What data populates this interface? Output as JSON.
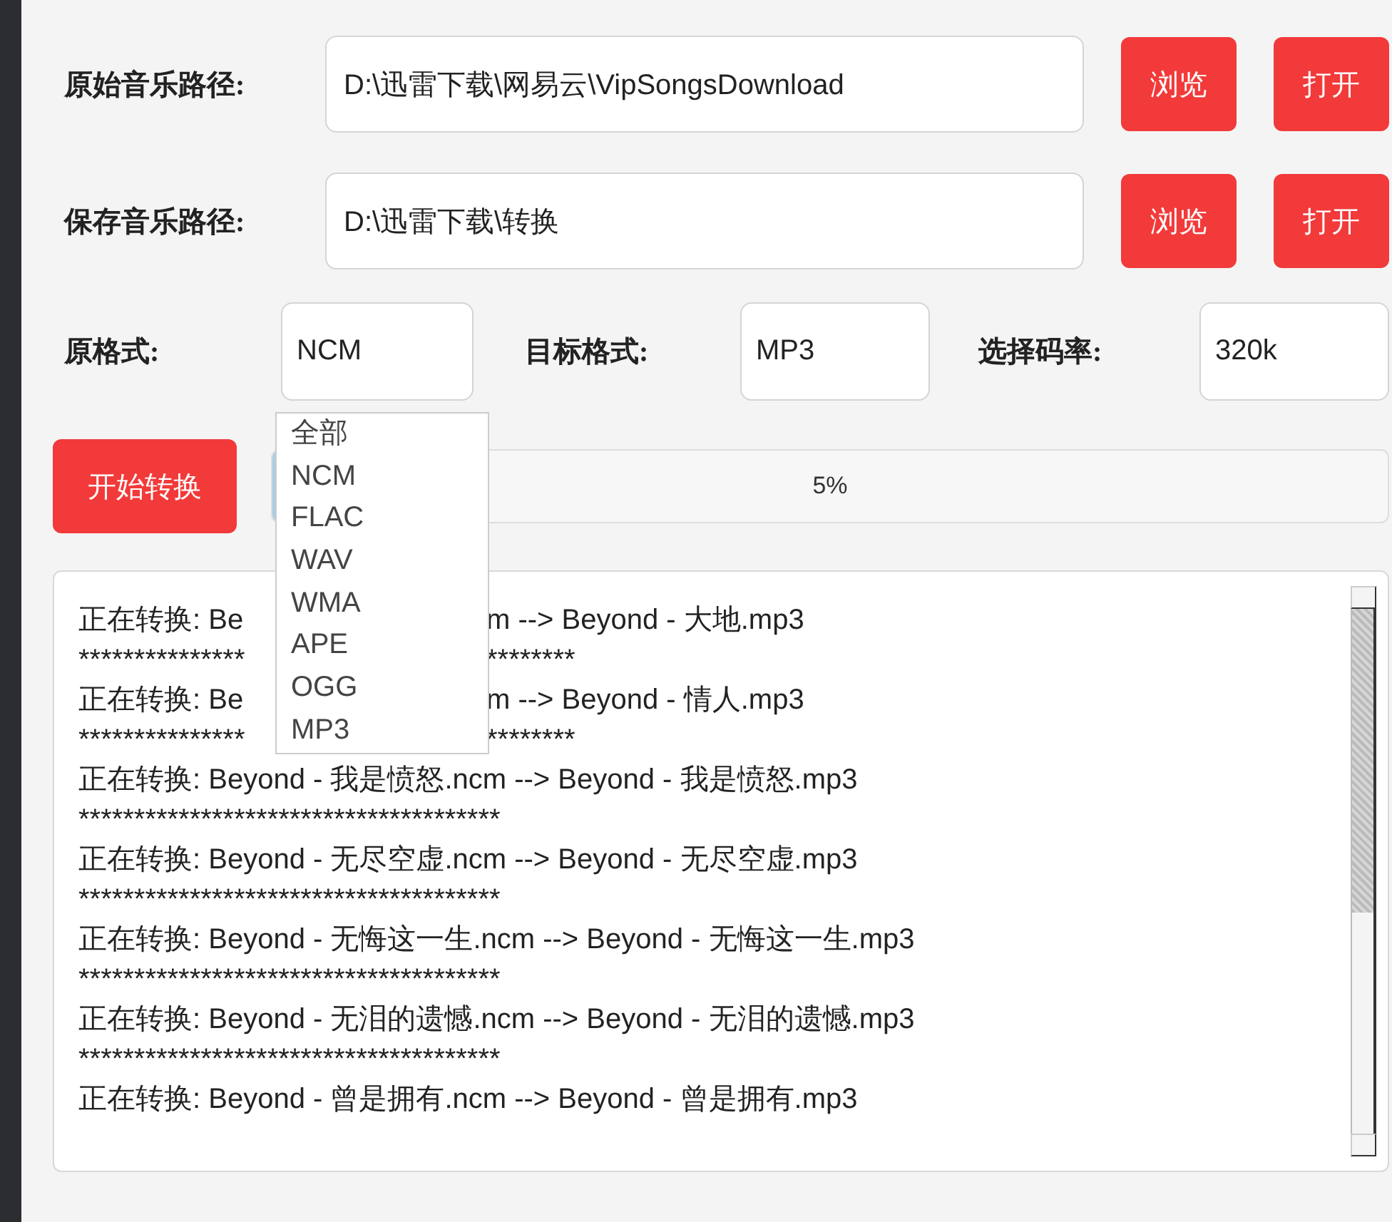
{
  "paths": [
    {
      "label": "原始音乐路径:",
      "value": "D:\\迅雷下载\\网易云\\VipSongsDownload",
      "buttons": [
        "浏览",
        "打开"
      ]
    },
    {
      "label": "保存音乐路径:",
      "value": "D:\\迅雷下载\\转换",
      "buttons": [
        "浏览",
        "打开"
      ]
    }
  ],
  "formats": [
    {
      "label": "原格式:",
      "value": "NCM"
    },
    {
      "label": "目标格式:",
      "value": "MP3"
    },
    {
      "label": "选择码率:",
      "value": "320k"
    }
  ],
  "format_dropdown": {
    "options": [
      "全部",
      "NCM",
      "FLAC",
      "WAV",
      "WMA",
      "APE",
      "OGG",
      "MP3"
    ]
  },
  "start_button": "开始转换",
  "progress": {
    "level": 0.05,
    "text": "5%"
  },
  "log": [
    {
      "kind": "covered",
      "start": "正在转换: Be",
      "end": "m --> Beyond - 大地.mp3"
    },
    {
      "kind": "covered",
      "start": "***************",
      "end": "********"
    },
    {
      "kind": "covered",
      "start": "正在转换: Be",
      "end": "m --> Beyond - 情人.mp3"
    },
    {
      "kind": "covered",
      "start": "***************",
      "end": "********"
    },
    {
      "kind": "line",
      "text": "正在转换: Beyond - 我是愤怒.ncm --> Beyond - 我是愤怒.mp3"
    },
    {
      "kind": "line",
      "text": "**************************************"
    },
    {
      "kind": "line",
      "text": "正在转换: Beyond - 无尽空虚.ncm --> Beyond - 无尽空虚.mp3"
    },
    {
      "kind": "line",
      "text": "**************************************"
    },
    {
      "kind": "line",
      "text": "正在转换: Beyond - 无悔这一生.ncm --> Beyond - 无悔这一生.mp3"
    },
    {
      "kind": "line",
      "text": "**************************************"
    },
    {
      "kind": "line",
      "text": "正在转换: Beyond - 无泪的遗憾.ncm --> Beyond - 无泪的遗憾.mp3"
    },
    {
      "kind": "line",
      "text": "**************************************"
    },
    {
      "kind": "line",
      "text": "正在转换: Beyond - 曾是拥有.ncm --> Beyond - 曾是拥有.mp3"
    }
  ]
}
